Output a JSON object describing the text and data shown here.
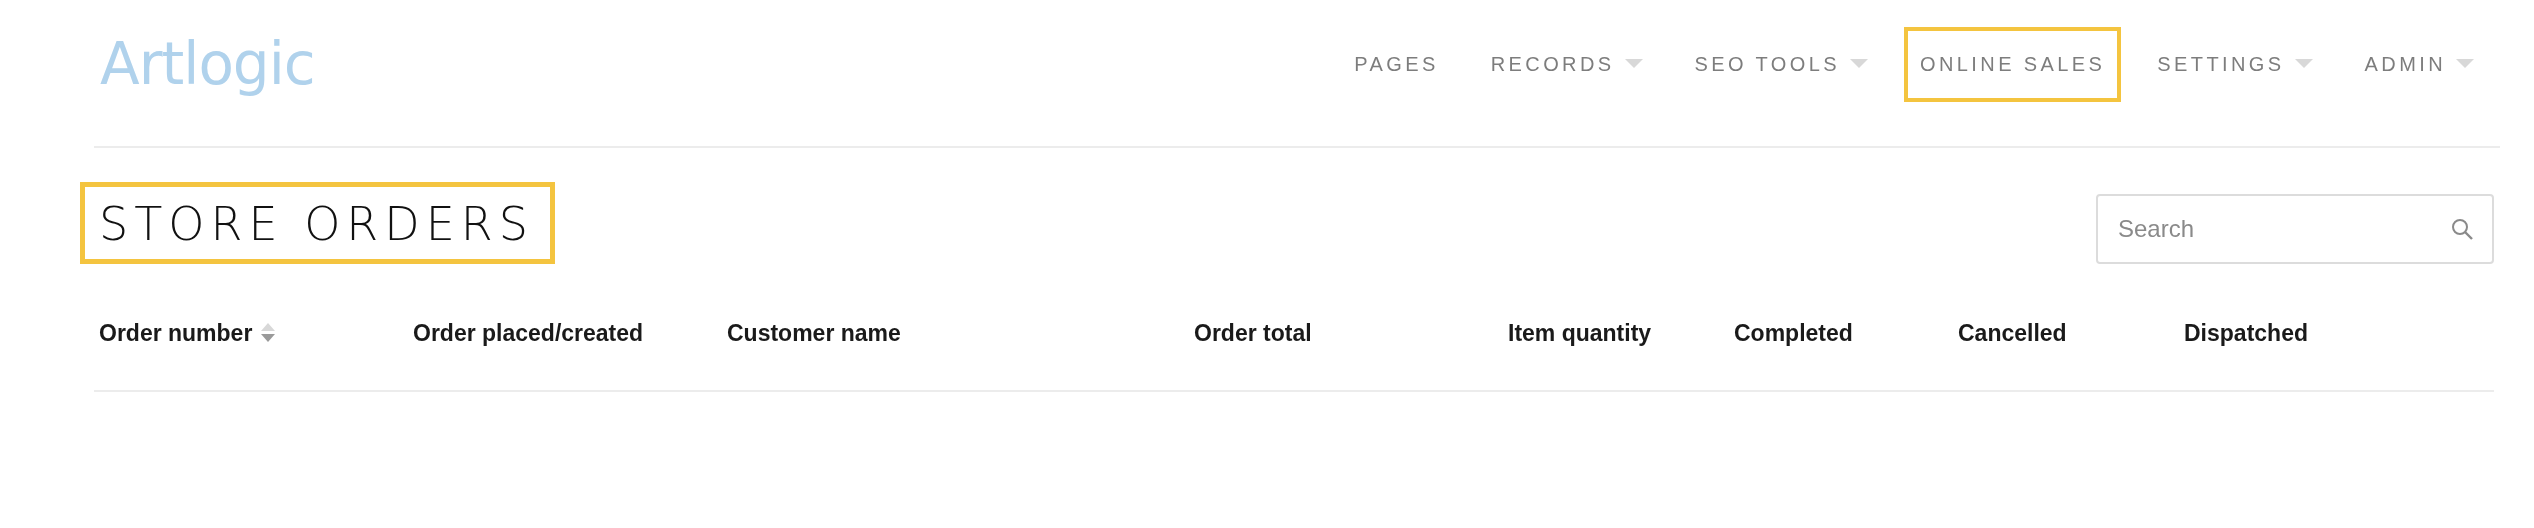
{
  "logo": "Artlogic",
  "nav": [
    {
      "label": "PAGES",
      "dropdown": false,
      "highlighted": false
    },
    {
      "label": "RECORDS",
      "dropdown": true,
      "highlighted": false
    },
    {
      "label": "SEO TOOLS",
      "dropdown": true,
      "highlighted": false
    },
    {
      "label": "ONLINE SALES",
      "dropdown": false,
      "highlighted": true
    },
    {
      "label": "SETTINGS",
      "dropdown": true,
      "highlighted": false
    },
    {
      "label": "ADMIN",
      "dropdown": true,
      "highlighted": false
    }
  ],
  "page_title": {
    "text": "STORE ORDERS",
    "highlighted": true
  },
  "search": {
    "placeholder": "Search"
  },
  "table": {
    "columns": [
      {
        "label": "Order number",
        "sortable": true
      },
      {
        "label": "Order placed/created",
        "sortable": false
      },
      {
        "label": "Customer name",
        "sortable": false
      },
      {
        "label": "Order total",
        "sortable": false
      },
      {
        "label": "Item quantity",
        "sortable": false
      },
      {
        "label": "Completed",
        "sortable": false
      },
      {
        "label": "Cancelled",
        "sortable": false
      },
      {
        "label": "Dispatched",
        "sortable": false
      }
    ]
  }
}
